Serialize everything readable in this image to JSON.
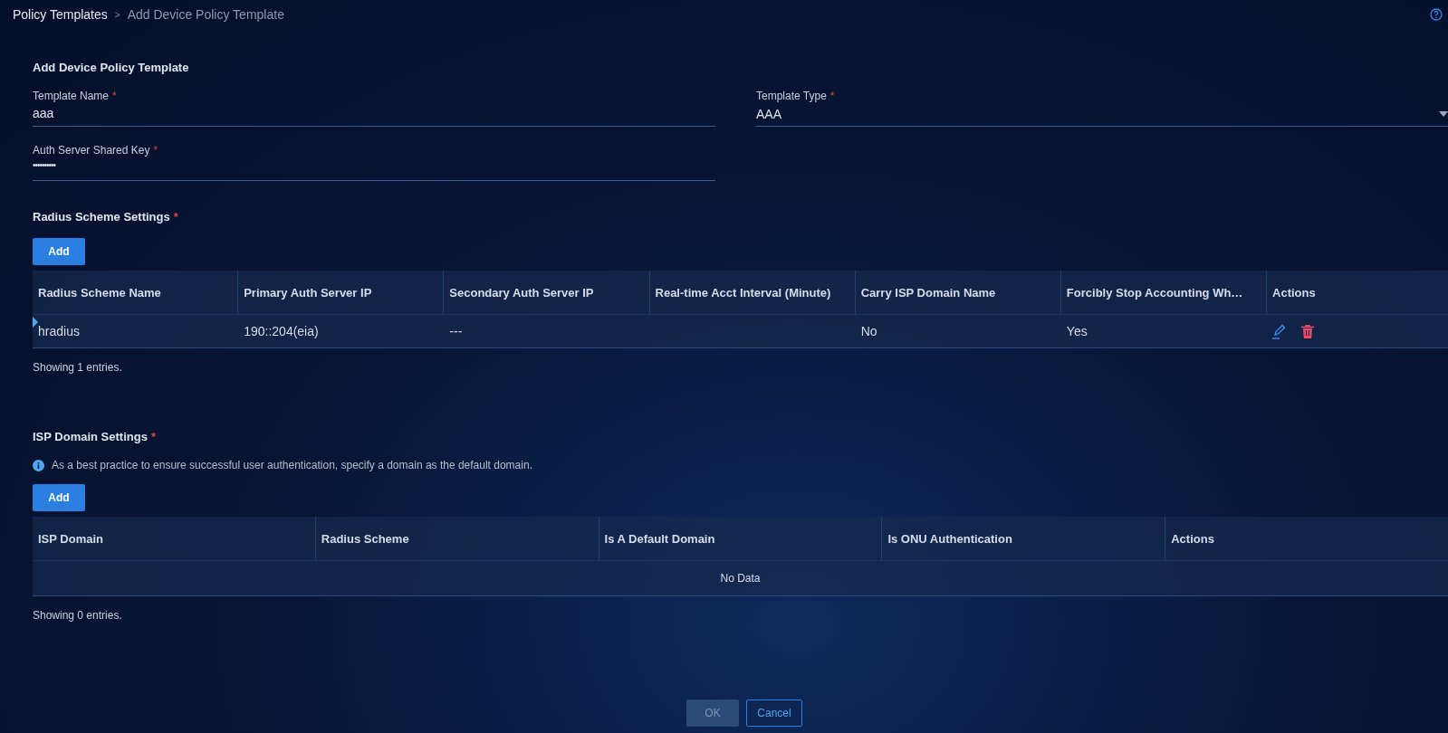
{
  "breadcrumb": [
    {
      "label": "Policy Templates",
      "current": false
    },
    {
      "label": "Add Device Policy Template",
      "current": true
    }
  ],
  "breadcrumb_separator": ">",
  "form_title": "Add Device Policy Template",
  "fields": [
    {
      "kind": "text",
      "label": "Template Name",
      "required_mark": "*",
      "value": "aaa"
    },
    {
      "kind": "select",
      "label": "Template Type",
      "required_mark": "*",
      "value": "AAA"
    },
    {
      "kind": "password",
      "label": "Auth Server Shared Key",
      "required_mark": "*",
      "value": "••••••••••"
    }
  ],
  "radius_section": {
    "title": "Radius Scheme Settings",
    "required_mark": "*",
    "add_button": "Add",
    "table": {
      "columns": [
        "Radius Scheme Name",
        "Primary Auth Server IP",
        "Secondary Auth Server IP",
        "Real-time Acct Interval (Minute)",
        "Carry ISP Domain Name",
        "Forcibly Stop Accounting Wh…",
        "Actions"
      ],
      "rows": [
        {
          "selected": true,
          "cells": [
            "hradius",
            "190::204(eia)",
            "---",
            "",
            "No",
            "Yes"
          ]
        }
      ]
    },
    "footer": "Showing 1 entries."
  },
  "isp_section": {
    "title": "ISP Domain Settings",
    "required_mark": "*",
    "hint": "As a best practice to ensure successful user authentication, specify a domain as the default domain.",
    "add_button": "Add",
    "table": {
      "columns": [
        "ISP Domain",
        "Radius Scheme",
        "Is A Default Domain",
        "Is ONU Authentication",
        "Actions"
      ],
      "empty_text": "No Data"
    },
    "footer": "Showing 0 entries."
  },
  "buttons": [
    {
      "kind": "primary",
      "label": "OK",
      "disabled": true
    },
    {
      "kind": "secondary",
      "label": "Cancel",
      "disabled": false
    }
  ]
}
